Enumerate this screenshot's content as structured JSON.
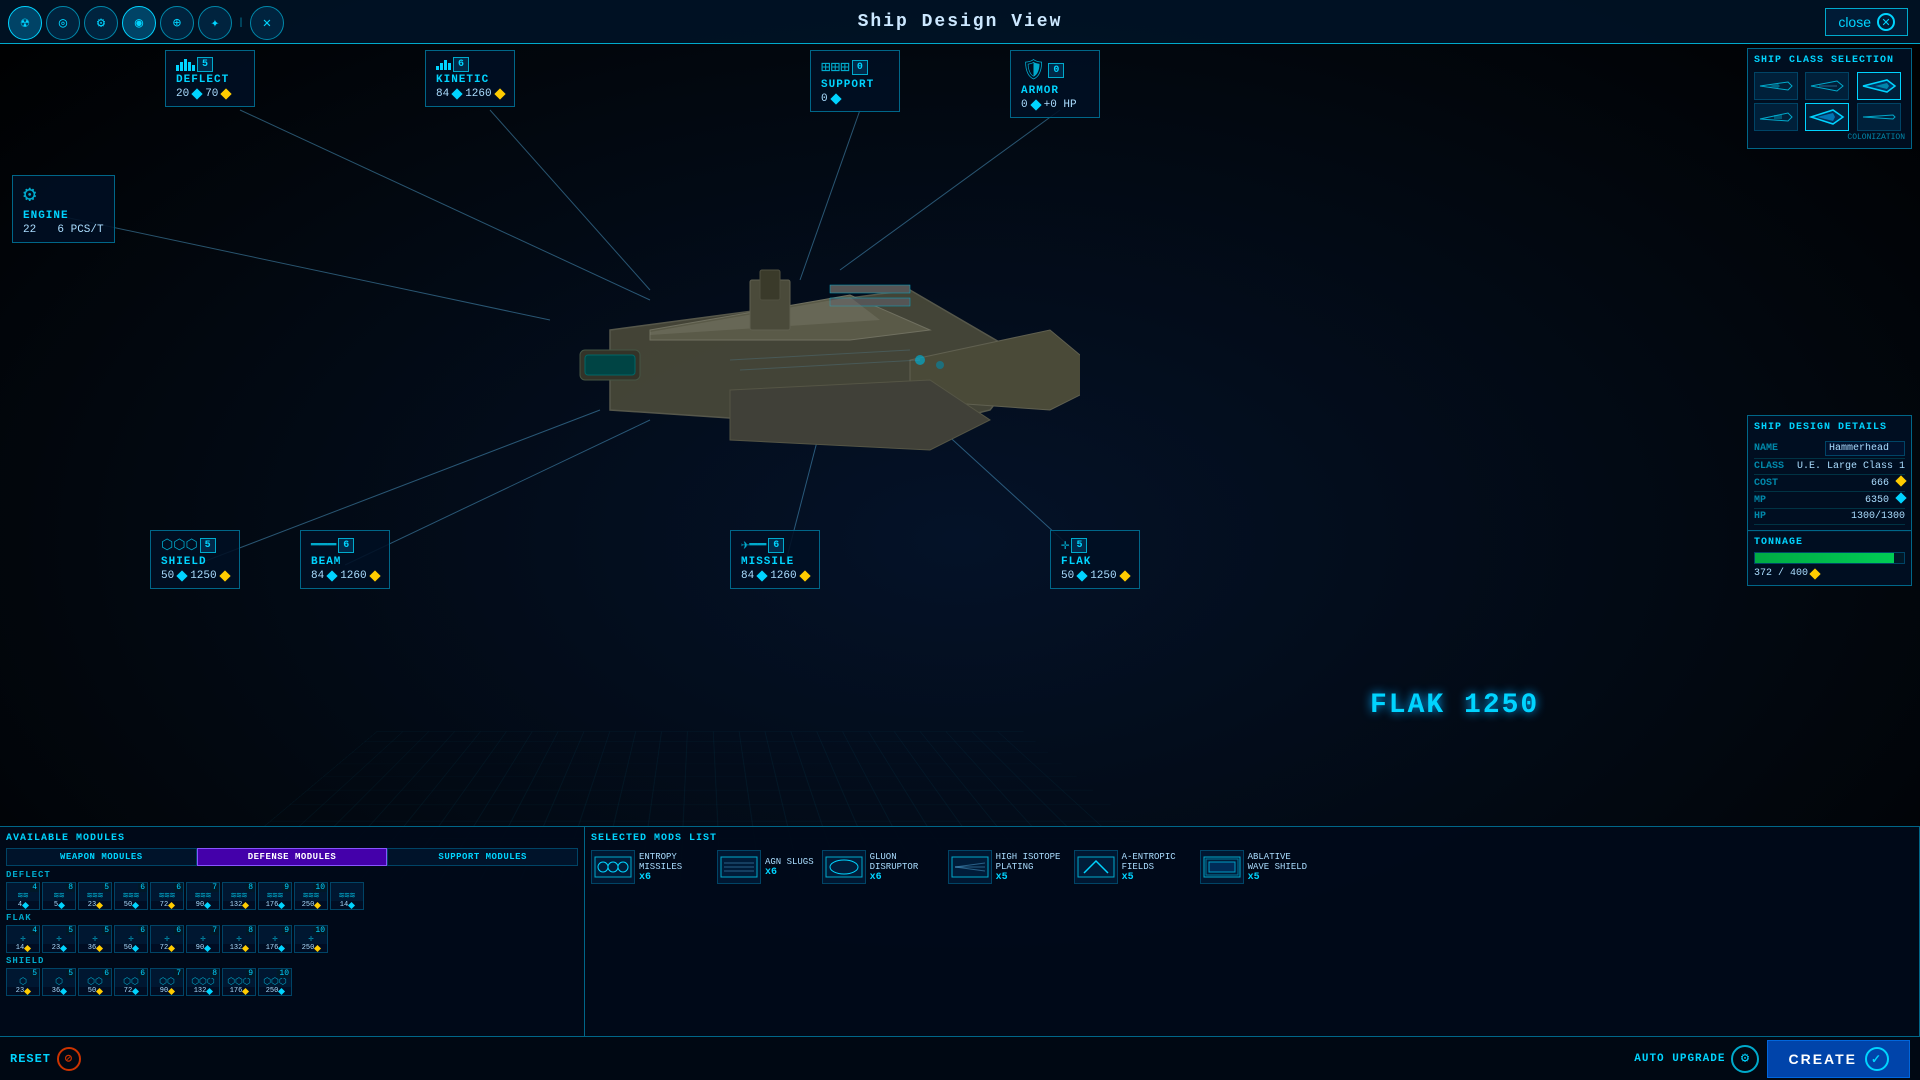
{
  "title": "Ship Design View",
  "close_label": "close",
  "nav_icons": [
    "☢",
    "◎",
    "⚙",
    "◉",
    "⊕",
    "✦",
    "✕"
  ],
  "stats": {
    "deflect": {
      "label": "DEFLECT",
      "count": 5,
      "val1": "20",
      "val2": "70"
    },
    "kinetic": {
      "label": "KINETIC",
      "count": 6,
      "val1": "84",
      "val2": "1260"
    },
    "support": {
      "label": "SUPPORT",
      "count": 0,
      "val1": "0"
    },
    "armor": {
      "label": "ARMOR",
      "count": 0,
      "val1": "0",
      "val2": "+0 HP"
    },
    "engine": {
      "label": "ENGINE",
      "val1": "22",
      "val2": "6 PCS/T"
    },
    "shield": {
      "label": "SHIELD",
      "count": 5,
      "val1": "50",
      "val2": "1250"
    },
    "beam": {
      "label": "BEAM",
      "count": 6,
      "val1": "84",
      "val2": "1260"
    },
    "missile": {
      "label": "MISSILE",
      "count": 6,
      "val1": "84",
      "val2": "1260"
    },
    "flak": {
      "label": "FLAK",
      "count": 5,
      "val1": "50",
      "val2": "1250"
    }
  },
  "ship_class_panel": {
    "title": "SHIP CLASS SELECTION",
    "colonization_label": "COLONIZATION"
  },
  "design_details": {
    "title": "SHIP DESIGN DETAILS",
    "name_label": "NAME",
    "name_value": "Hammerhead",
    "class_label": "CLASS",
    "class_value": "U.E. Large Class 1",
    "cost_label": "COST",
    "cost_value": "666",
    "mp_label": "MP",
    "mp_value": "6350",
    "hp_label": "HP",
    "hp_value": "1300/1300"
  },
  "tonnage": {
    "label": "TONNAGE",
    "current": 372,
    "max": 400,
    "display": "372 / 400",
    "bar_pct": 93
  },
  "available_modules": {
    "title": "AVAILABLE MODULES",
    "tabs": [
      "WEAPON MODULES",
      "DEFENSE MODULES",
      "SUPPORT MODULES"
    ],
    "active_tab": 1,
    "rows": [
      {
        "label": "DEFLECT",
        "items": [
          {
            "count": 4,
            "cost1": "4",
            "cost2": ""
          },
          {
            "count": 8,
            "cost1": "5",
            "cost2": ""
          },
          {
            "count": 5,
            "cost1": "23"
          },
          {
            "count": 6,
            "cost1": ""
          },
          {
            "count": 6,
            "cost1": "50"
          },
          {
            "count": 6,
            "cost1": "72"
          },
          {
            "count": 7,
            "cost1": "90"
          },
          {
            "count": 8,
            "cost1": "132"
          },
          {
            "count": 9,
            "cost1": "176"
          },
          {
            "count": 10,
            "cost1": "250"
          },
          {
            "count": "",
            "cost1": "14"
          }
        ]
      },
      {
        "label": "FLAK",
        "items": [
          {
            "count": 4,
            "cost1": "14"
          },
          {
            "count": 5,
            "cost1": "23"
          },
          {
            "count": 5,
            "cost1": "36"
          },
          {
            "count": 6,
            "cost1": ""
          },
          {
            "count": 6,
            "cost1": "50"
          },
          {
            "count": 6,
            "cost1": "72"
          },
          {
            "count": 7,
            "cost1": "90"
          },
          {
            "count": 8,
            "cost1": "132"
          },
          {
            "count": 9,
            "cost1": "176"
          },
          {
            "count": 10,
            "cost1": "250"
          }
        ]
      },
      {
        "label": "SHIELD",
        "items": [
          {
            "count": 5,
            "cost1": "23"
          },
          {
            "count": 5,
            "cost1": "36"
          },
          {
            "count": 6,
            "cost1": "50"
          },
          {
            "count": 6,
            "cost1": "72"
          },
          {
            "count": 7,
            "cost1": "90"
          },
          {
            "count": 8,
            "cost1": "132"
          },
          {
            "count": 9,
            "cost1": "176"
          },
          {
            "count": 10,
            "cost1": "250"
          }
        ]
      }
    ]
  },
  "selected_mods": {
    "title": "SELECTED MODS LIST",
    "items": [
      {
        "name": "ENTROPY MISSILES",
        "count": "x6"
      },
      {
        "name": "AGN SLUGS",
        "count": "x6"
      },
      {
        "name": "GLUON DISRUPTOR",
        "count": "x6"
      },
      {
        "name": "HIGH ISOTOPE PLATING",
        "count": "x5"
      },
      {
        "name": "A-ENTROPIC FIELDS",
        "count": "x5"
      },
      {
        "name": "ABLATIVE WAVE SHIELD",
        "count": "x5"
      }
    ]
  },
  "bottom_bar": {
    "reset_label": "RESET",
    "auto_upgrade_label": "AUTO UPGRADE",
    "create_label": "CREATE"
  },
  "flak_big_label": "FLAK 1250"
}
